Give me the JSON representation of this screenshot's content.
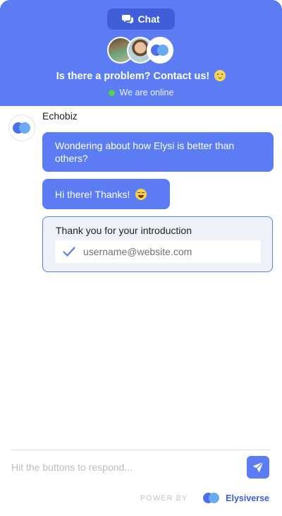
{
  "header": {
    "chat_label": "Chat",
    "headline": "Is there a problem? Contact us!",
    "status": "We are online"
  },
  "conversation": {
    "bot_name": "Echobiz",
    "messages": [
      {
        "text": "Wondering about how Elysi is better than others?"
      },
      {
        "text": "Hi there! Thanks!"
      }
    ],
    "form": {
      "label": "Thank you for your introduction",
      "email_placeholder": "username@website.com"
    }
  },
  "composer": {
    "placeholder": "Hit the buttons to respond..."
  },
  "footer": {
    "powered_label": "POWER BY",
    "brand": "Elysiverse"
  },
  "colors": {
    "primary": "#5b7cf2",
    "pill": "#3f5ed8",
    "online": "#58d04b",
    "form_bg": "#eef1f7"
  },
  "icons": {
    "chat_pill": "chat-bubbles-icon",
    "check": "check-icon",
    "send": "paper-plane-icon",
    "brand": "elysiverse-logo-icon"
  }
}
